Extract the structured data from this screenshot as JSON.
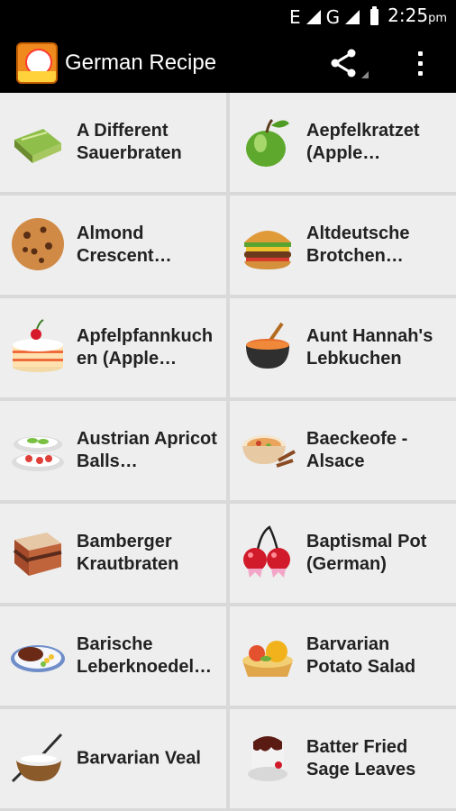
{
  "status_bar": {
    "network": "E",
    "network2": "G",
    "time": "2:25",
    "ampm": "pm"
  },
  "app_bar": {
    "title": "German Recipe"
  },
  "recipes": [
    {
      "label": "A Different\nSauerbraten",
      "icon": "cake-slice-icon"
    },
    {
      "label": "Aepfelkratzet\n(Apple…",
      "icon": "apple-icon"
    },
    {
      "label": "Almond\nCrescent…",
      "icon": "cookie-icon"
    },
    {
      "label": "Altdeutsche\nBrotchen…",
      "icon": "burger-icon"
    },
    {
      "label": "Apfelpfannkuch\nen (Apple…",
      "icon": "layer-cake-icon"
    },
    {
      "label": "Aunt Hannah's\nLebkuchen",
      "icon": "cooking-pot-icon"
    },
    {
      "label": "Austrian Apricot\nBalls…",
      "icon": "salad-plates-icon"
    },
    {
      "label": "Baeckeofe -\nAlsace",
      "icon": "soup-bowl-icon"
    },
    {
      "label": "Bamberger\nKrautbraten",
      "icon": "brownie-icon"
    },
    {
      "label": "Baptismal Pot\n(German)",
      "icon": "cherries-icon"
    },
    {
      "label": "Barische\nLeberknoedel…",
      "icon": "steak-plate-icon"
    },
    {
      "label": "Barvarian\nPotato Salad",
      "icon": "fruit-tart-icon"
    },
    {
      "label": "Barvarian Veal",
      "icon": "rice-bowl-icon"
    },
    {
      "label": "Batter Fried\nSage Leaves",
      "icon": "chocolate-dessert-icon"
    }
  ]
}
